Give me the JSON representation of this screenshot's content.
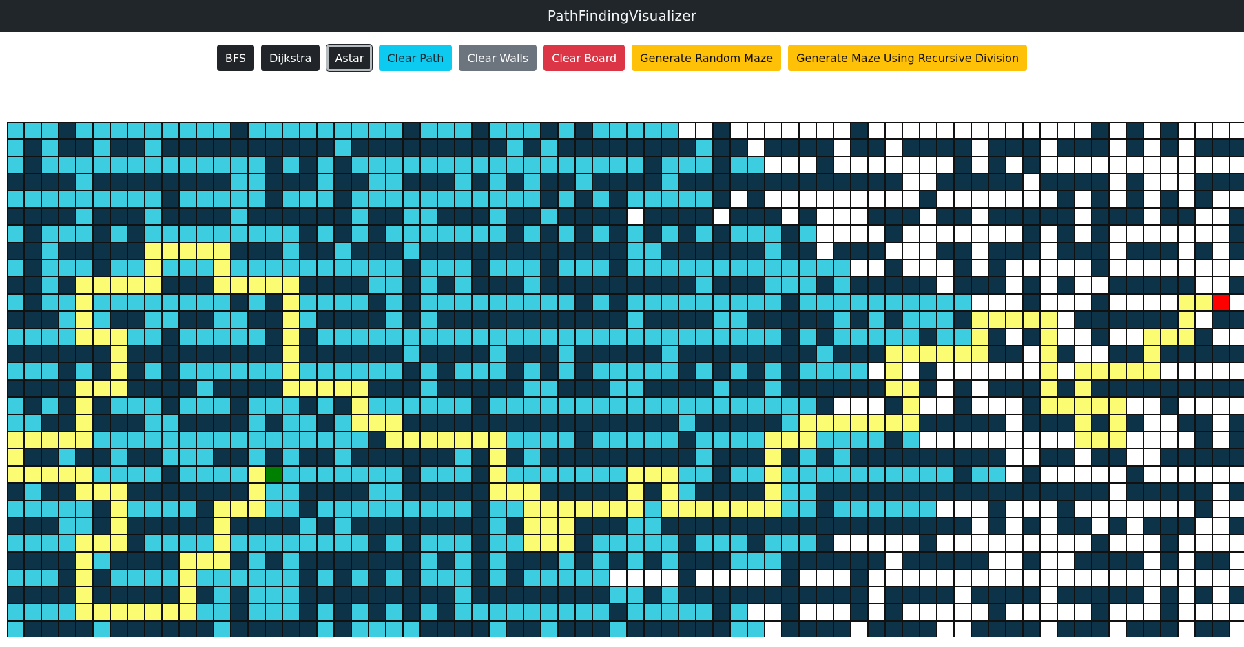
{
  "app": {
    "title": "PathFindingVisualizer"
  },
  "toolbar": {
    "buttons": [
      {
        "id": "bfs",
        "label": "BFS",
        "style": "dark"
      },
      {
        "id": "dijkstra",
        "label": "Dijkstra",
        "style": "dark"
      },
      {
        "id": "astar",
        "label": "Astar",
        "style": "dark",
        "active": true
      },
      {
        "id": "clear-path",
        "label": "Clear Path",
        "style": "info"
      },
      {
        "id": "clear-walls",
        "label": "Clear Walls",
        "style": "secondary"
      },
      {
        "id": "clear-board",
        "label": "Clear Board",
        "style": "danger"
      },
      {
        "id": "random-maze",
        "label": "Generate Random Maze",
        "style": "warning"
      },
      {
        "id": "recursive-maze",
        "label": "Generate Maze Using Recursive Division",
        "style": "warning"
      }
    ]
  },
  "grid": {
    "rows": 30,
    "cols": 72,
    "start": {
      "row": 20,
      "col": 15
    },
    "end": {
      "row": 10,
      "col": 70
    },
    "colors": {
      "empty": "#ffffff",
      "wall": "#0d3349",
      "visited": "#3dcde0",
      "path": "#fcfc72",
      "start": "#008000",
      "end": "#ff0000",
      "border": "#111111"
    },
    "visited_frontier_col": 38
  }
}
